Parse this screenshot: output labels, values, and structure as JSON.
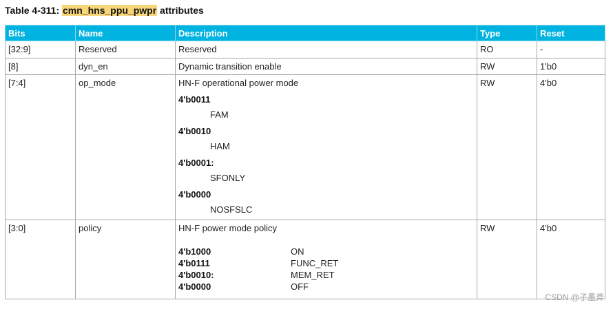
{
  "title": {
    "prefix": "Table 4-311:",
    "register": "cmn_hns_ppu_pwpr",
    "suffix": "attributes"
  },
  "table": {
    "headers": [
      "Bits",
      "Name",
      "Description",
      "Type",
      "Reset"
    ],
    "rows": [
      {
        "bits": "[32:9]",
        "name": "Reserved",
        "description": "Reserved",
        "type": "RO",
        "reset": "-"
      },
      {
        "bits": "[8]",
        "name": "dyn_en",
        "description": "Dynamic transition enable",
        "type": "RW",
        "reset": "1'b0"
      },
      {
        "bits": "[7:4]",
        "name": "op_mode",
        "description": "HN-F operational power mode",
        "type": "RW",
        "reset": "4'b0",
        "enums": [
          {
            "code": "4'b0011",
            "value": "FAM"
          },
          {
            "code": "4'b0010",
            "value": "HAM"
          },
          {
            "code": "4'b0001:",
            "value": "SFONLY"
          },
          {
            "code": "4'b0000",
            "value": "NOSFSLC"
          }
        ]
      },
      {
        "bits": "[3:0]",
        "name": "policy",
        "description": "HN-F power mode policy",
        "type": "RW",
        "reset": "4'b0",
        "enums": [
          {
            "code": "4'b1000",
            "value": "ON"
          },
          {
            "code": "4'b0111",
            "value": "FUNC_RET"
          },
          {
            "code": "4'b0010:",
            "value": "MEM_RET"
          },
          {
            "code": "4'b0000",
            "value": "OFF"
          }
        ]
      }
    ]
  },
  "watermark": "CSDN @子墨斧"
}
